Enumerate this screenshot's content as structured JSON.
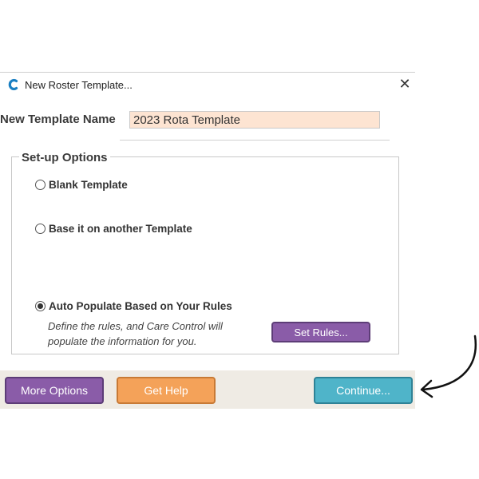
{
  "dialog": {
    "title": "New Roster Template...",
    "app_icon": "care-control-c-icon",
    "close_icon": "close-icon",
    "close_glyph": "✕"
  },
  "template_name": {
    "label": "New Template Name",
    "value": "2023 Rota Template"
  },
  "setup_options": {
    "legend": "Set-up Options",
    "options": [
      {
        "label": "Blank Template",
        "checked": false
      },
      {
        "label": "Base it on another Template",
        "checked": false
      },
      {
        "label": "Auto Populate Based on Your Rules",
        "checked": true
      }
    ],
    "description_line1": "Define the rules, and Care Control will",
    "description_line2": "populate the information for you.",
    "set_rules_label": "Set Rules..."
  },
  "footer": {
    "more_options_label": "More Options",
    "get_help_label": "Get Help",
    "continue_label": "Continue..."
  },
  "colors": {
    "purple_button": "#8a5ca8",
    "orange_button": "#f4a259",
    "teal_button": "#4fb4c9",
    "input_bg": "#fde4d2",
    "footer_bg": "#efebe4",
    "accent_blue": "#1a7fc2"
  },
  "annotation": {
    "icon": "curved-arrow-icon"
  }
}
